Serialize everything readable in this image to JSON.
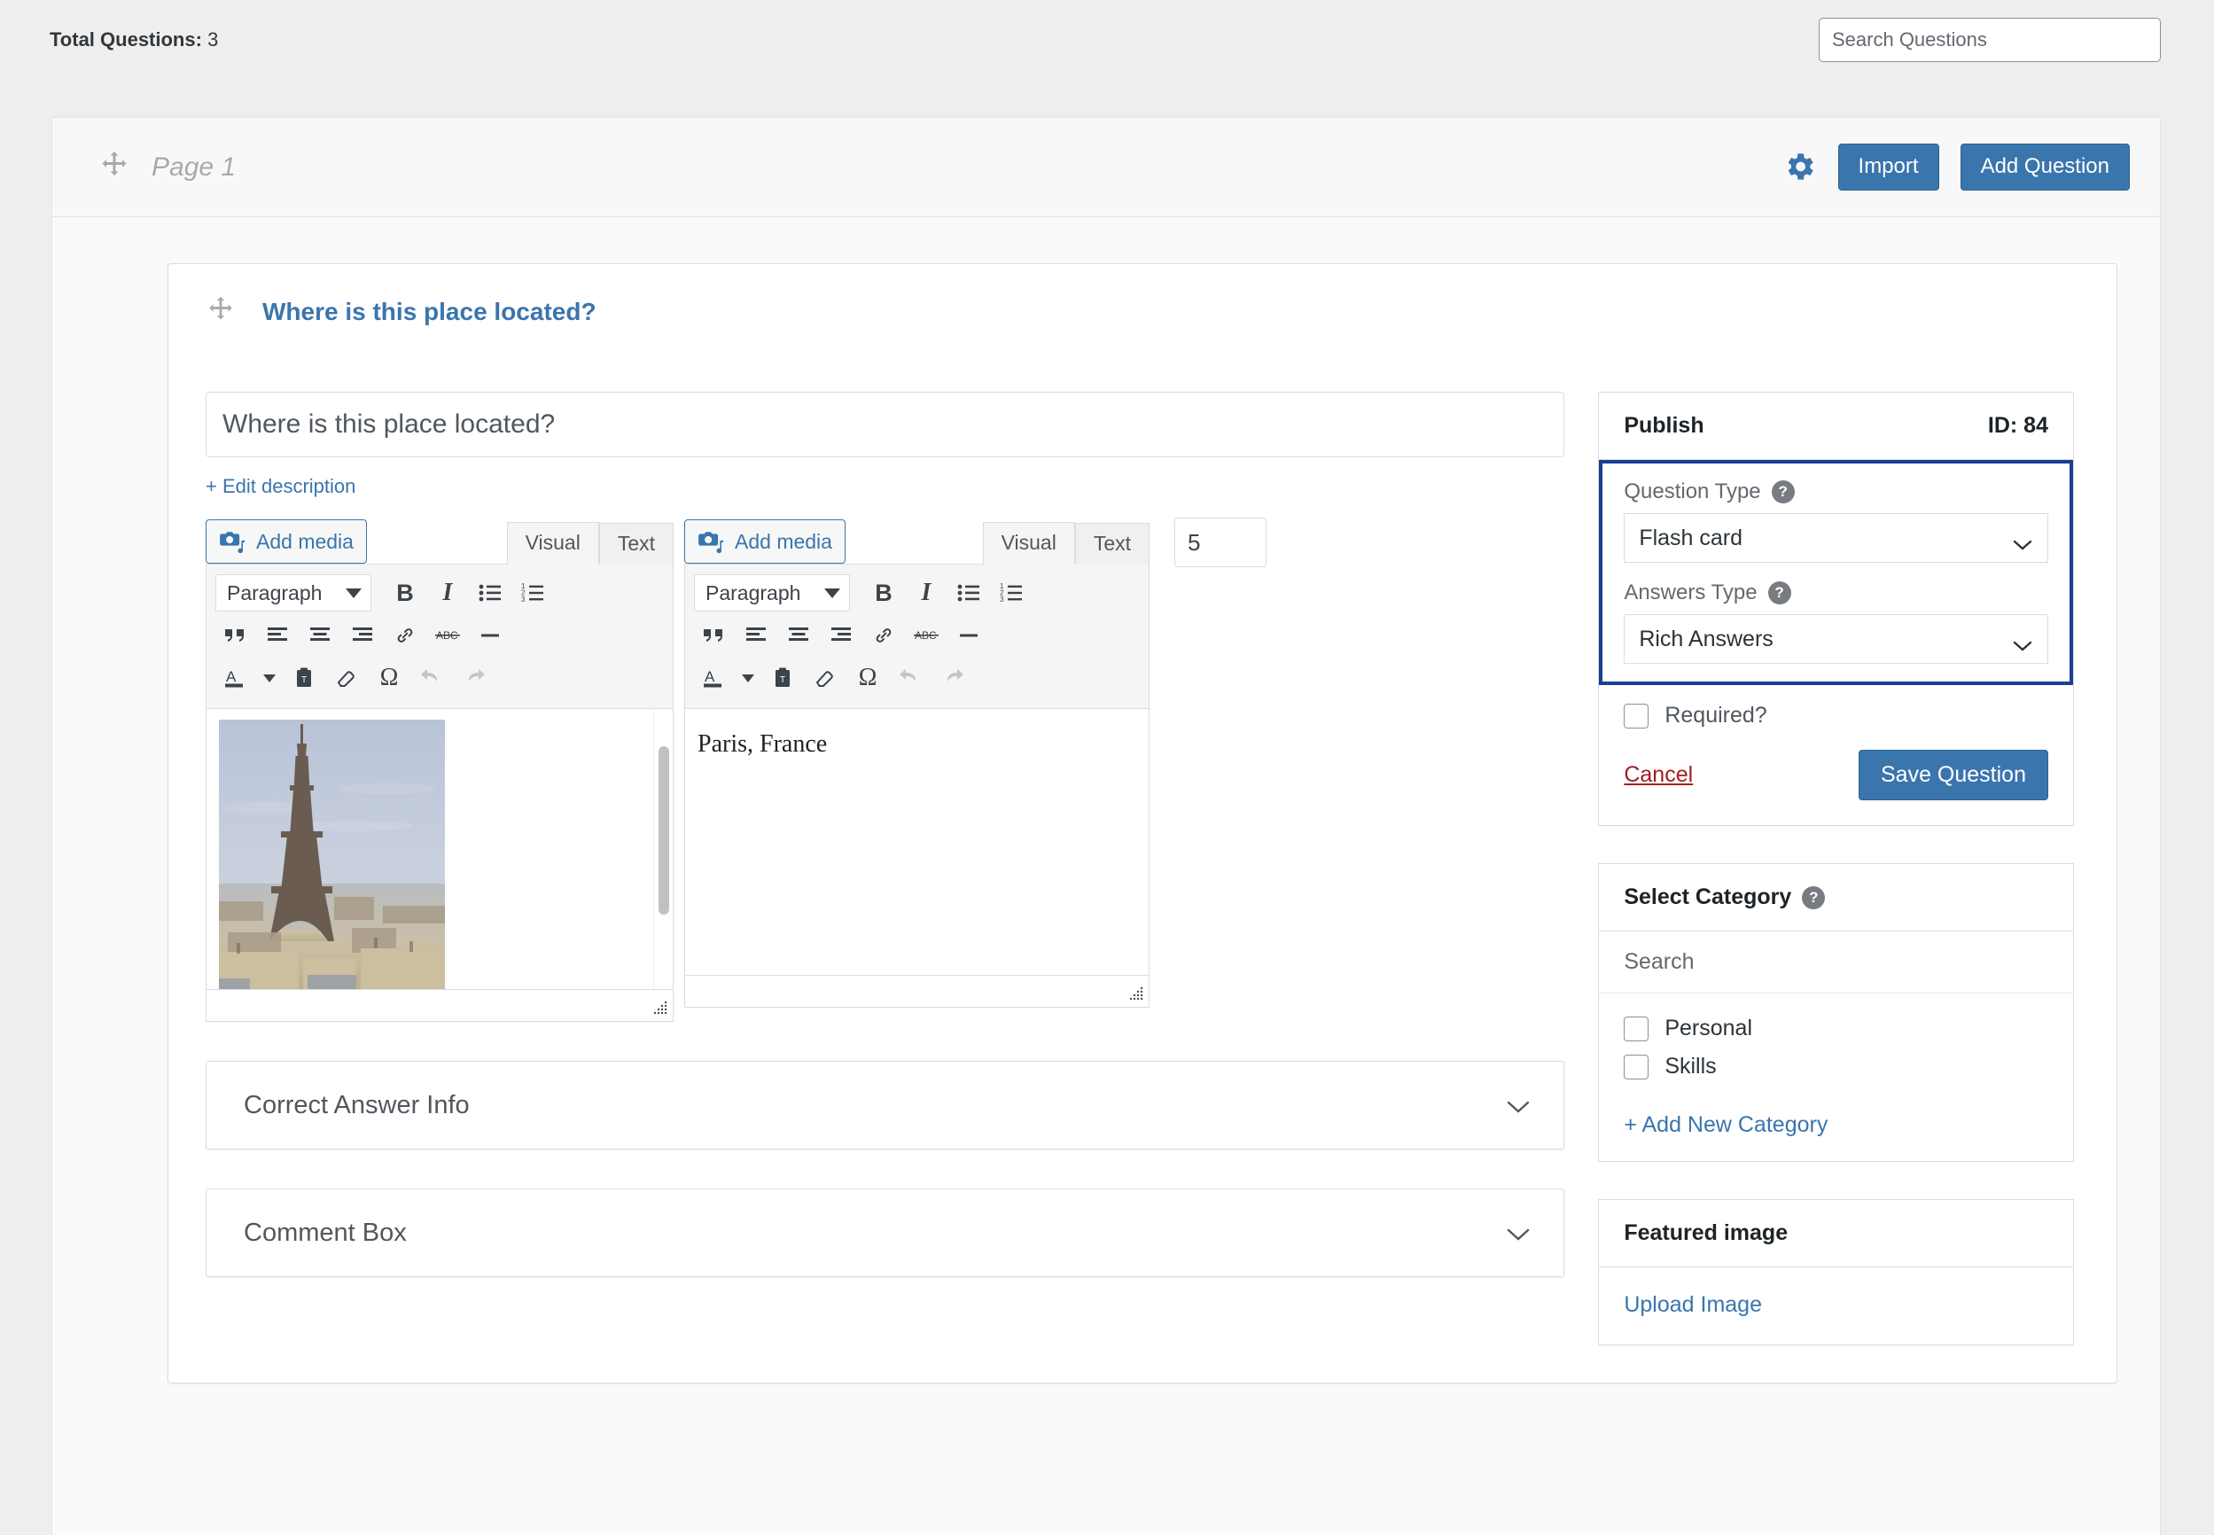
{
  "topbar": {
    "total_questions_label": "Total Questions:",
    "total_questions_value": "3",
    "search_placeholder": "Search Questions"
  },
  "page_header": {
    "drag_icon": "move-icon",
    "title": "Page 1",
    "gear_icon": "gear-icon",
    "import_label": "Import",
    "add_question_label": "Add Question"
  },
  "question": {
    "header_title": "Where is this place located?",
    "title_value": "Where is this place located?",
    "edit_description_label": "+ Edit description",
    "points_value": "5",
    "answer_text": "Paris, France",
    "editor_left": {
      "add_media_label": "Add media",
      "tab_visual": "Visual",
      "tab_text": "Text",
      "active_tab": "Visual",
      "format_select": "Paragraph"
    },
    "editor_right": {
      "add_media_label": "Add media",
      "tab_visual": "Visual",
      "tab_text": "Text",
      "active_tab": "Visual",
      "format_select": "Paragraph"
    },
    "toolbar_icons": [
      "bold-icon",
      "italic-icon",
      "bulleted-list-icon",
      "numbered-list-icon",
      "blockquote-icon",
      "align-left-icon",
      "align-center-icon",
      "align-right-icon",
      "link-icon",
      "strikethrough-icon",
      "horizontal-rule-icon",
      "text-color-icon",
      "paste-as-text-icon",
      "clear-formatting-icon",
      "special-character-icon",
      "undo-icon",
      "redo-icon"
    ],
    "accordions": [
      {
        "label": "Correct Answer Info",
        "chevron": "chevron-down-icon"
      },
      {
        "label": "Comment Box",
        "chevron": "chevron-down-icon"
      }
    ]
  },
  "sidebar": {
    "publish": {
      "title": "Publish",
      "id_label": "ID: 84",
      "question_type_label": "Question Type",
      "question_type_value": "Flash card",
      "answers_type_label": "Answers Type",
      "answers_type_value": "Rich Answers",
      "required_label": "Required?",
      "required_checked": false,
      "cancel_label": "Cancel",
      "save_label": "Save Question",
      "highlight_color": "#1b3f91"
    },
    "category": {
      "title": "Select Category",
      "search_placeholder": "Search",
      "items": [
        {
          "label": "Personal",
          "checked": false
        },
        {
          "label": "Skills",
          "checked": false
        }
      ],
      "add_new_label": "+ Add New Category"
    },
    "featured_image": {
      "title": "Featured image",
      "upload_label": "Upload Image"
    }
  },
  "colors": {
    "accent_blue": "#3a75ad",
    "link_blue": "#3a75ad",
    "danger_red": "#a02020",
    "highlight_border": "#1b3f91",
    "page_bg": "#eeeeee",
    "panel_bg": "#fafafa"
  }
}
